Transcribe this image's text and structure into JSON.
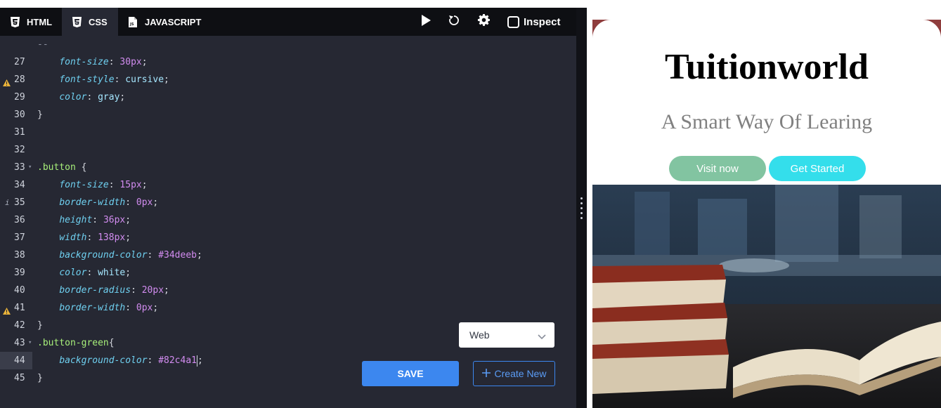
{
  "tabs": [
    {
      "label": "HTML",
      "icon": "html5-icon"
    },
    {
      "label": "CSS",
      "icon": "css3-icon"
    },
    {
      "label": "JAVASCRIPT",
      "icon": "js-file-icon"
    }
  ],
  "toolbar": {
    "run_icon": "play-icon",
    "reset_icon": "reset-icon",
    "settings_icon": "gear-icon",
    "inspect_label": "Inspect"
  },
  "editor": {
    "lines": [
      {
        "n": "27",
        "text": "    font-size: 30px;"
      },
      {
        "n": "28",
        "text": "    font-style: cursive;",
        "warning": true
      },
      {
        "n": "29",
        "text": "    color: gray;"
      },
      {
        "n": "30",
        "text": "}"
      },
      {
        "n": "31",
        "text": ""
      },
      {
        "n": "32",
        "text": ""
      },
      {
        "n": "33",
        "text": ".button {",
        "fold": true
      },
      {
        "n": "34",
        "text": "    font-size: 15px;"
      },
      {
        "n": "35",
        "text": "    border-width: 0px;",
        "info": true
      },
      {
        "n": "36",
        "text": "    height: 36px;"
      },
      {
        "n": "37",
        "text": "    width: 138px;"
      },
      {
        "n": "38",
        "text": "    background-color: #34deeb;"
      },
      {
        "n": "39",
        "text": "    color: white;"
      },
      {
        "n": "40",
        "text": "    border-radius: 20px;"
      },
      {
        "n": "41",
        "text": "    border-width: 0px;",
        "warning": true
      },
      {
        "n": "42",
        "text": "}"
      },
      {
        "n": "43",
        "text": ".button-green{",
        "fold": true
      },
      {
        "n": "44",
        "text": "    background-color: #82c4a1;",
        "active": true
      },
      {
        "n": "45",
        "text": "}"
      }
    ]
  },
  "controls": {
    "platform_value": "Web",
    "save_label": "SAVE",
    "create_label": "Create New"
  },
  "preview": {
    "title": "Tuitionworld",
    "subtitle": "A Smart Way Of Learing",
    "visit_label": "Visit now",
    "start_label": "Get Started",
    "image_subject": "stacked-books-photo"
  },
  "colors": {
    "accent": "#3c87ef",
    "editor_bg": "#262833",
    "tabbar_bg": "#0e0f13",
    "button_green": "#82c4a1",
    "button_blue": "#34deeb"
  }
}
